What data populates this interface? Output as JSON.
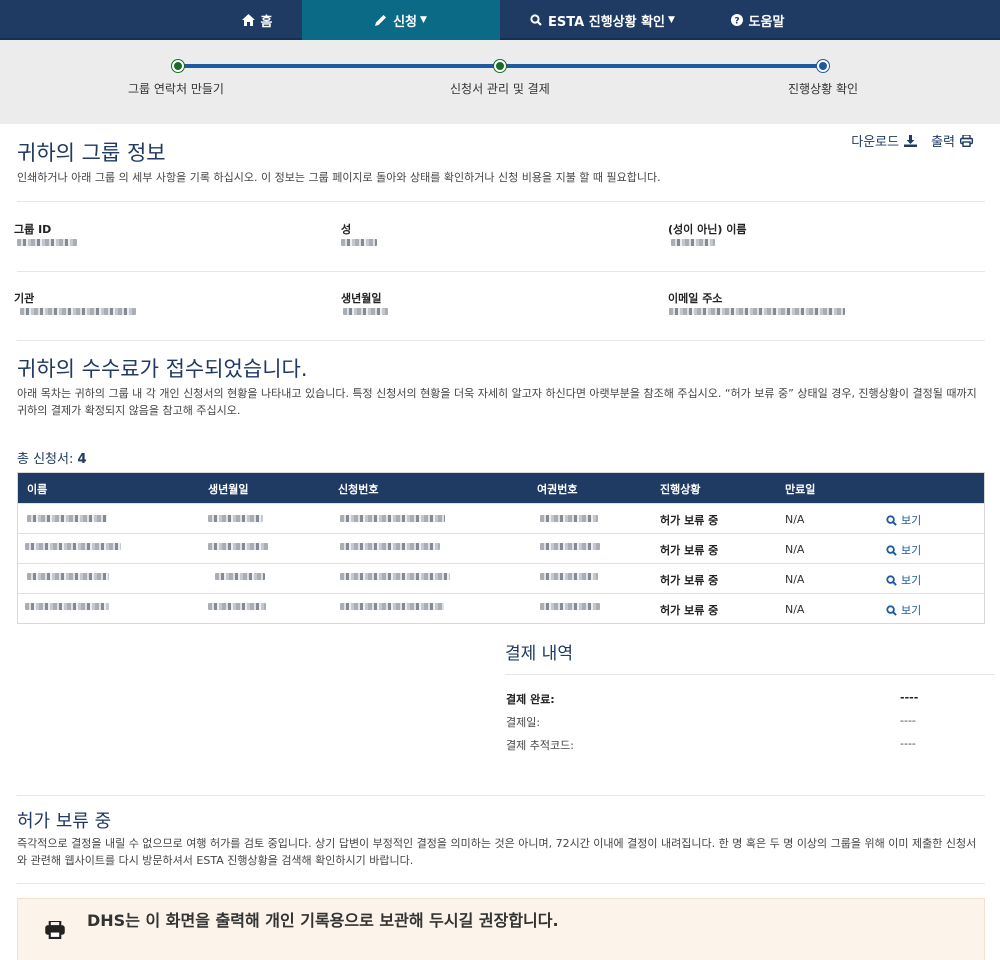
{
  "nav": {
    "home": "홈",
    "apply": "신청",
    "check_status": "ESTA 진행상황 확인",
    "help": "도움말"
  },
  "progress": {
    "steps": [
      "그룹 연락처 만들기",
      "신청서 관리 및 결제",
      "진행상황 확인"
    ]
  },
  "group_info": {
    "title": "귀하의 그룹 정보",
    "description": "인쇄하거나 아래 그룹 의 세부 사항을 기록 하십시오. 이 정보는 그룹 페이지로 돌아와 상태를 확인하거나 신청 비용을 지불 할 때 필요합니다.",
    "download_label": "다운로드",
    "print_label": "출력",
    "fields": {
      "group_id": "그룹 ID",
      "surname": "성",
      "given_name": "(성이 아닌) 이름",
      "organization": "기관",
      "birth_date": "생년월일",
      "email": "이메일 주소"
    }
  },
  "fee": {
    "title": "귀하의 수수료가 접수되었습니다.",
    "description": "아래 목차는 귀하의 그룹 내 각 개인 신청서의 현황을 나타내고 있습니다. 특정 신청서의 현황을 더욱 자세히 알고자 하신다면 아랫부분을 참조해 주십시오. “허가 보류 중” 상태일 경우, 진행상황이 결정될 때까지 귀하의 결제가 확정되지 않음을 참고해 주십시오."
  },
  "applications": {
    "total_label": "총 신청서:",
    "total_count": "4",
    "columns": [
      "이름",
      "생년월일",
      "신청번호",
      "여권번호",
      "진행상황",
      "만료일",
      ""
    ],
    "rows": [
      {
        "status": "허가 보류 중",
        "expiry": "N/A",
        "view": "보기"
      },
      {
        "status": "허가 보류 중",
        "expiry": "N/A",
        "view": "보기"
      },
      {
        "status": "허가 보류 중",
        "expiry": "N/A",
        "view": "보기"
      },
      {
        "status": "허가 보류 중",
        "expiry": "N/A",
        "view": "보기"
      }
    ]
  },
  "payment": {
    "title": "결제 내역",
    "completed_label": "결제 완료:",
    "completed_value": "----",
    "date_label": "결제일:",
    "date_value": "----",
    "tracking_label": "결제 추적코드:",
    "tracking_value": "----"
  },
  "pending": {
    "title": "허가 보류 중",
    "description": "즉각적으로 결정을 내릴 수 없으므로 여행 허가를 검토 중입니다. 상기 답변이 부정적인 결정을 의미하는 것은 아니며, 72시간 이내에 결정이 내려집니다. 한 명 혹은 두 명 이상의 그룹을 위해 이미 제출한 신청서와 관련해 웹사이트를 다시 방문하셔서 ESTA 진행상황을 검색해 확인하시기 바랍니다."
  },
  "notice": {
    "text": "DHS는 이 화면을 출력해 개인 기록용으로 보관해 두시길 권장합니다."
  },
  "colors": {
    "nav_bg": "#1f3a63",
    "nav_active": "#0b6a86",
    "accent": "#1f5aa0",
    "step_done": "#1b6b2a",
    "notice_bg": "#fcf4ea"
  }
}
